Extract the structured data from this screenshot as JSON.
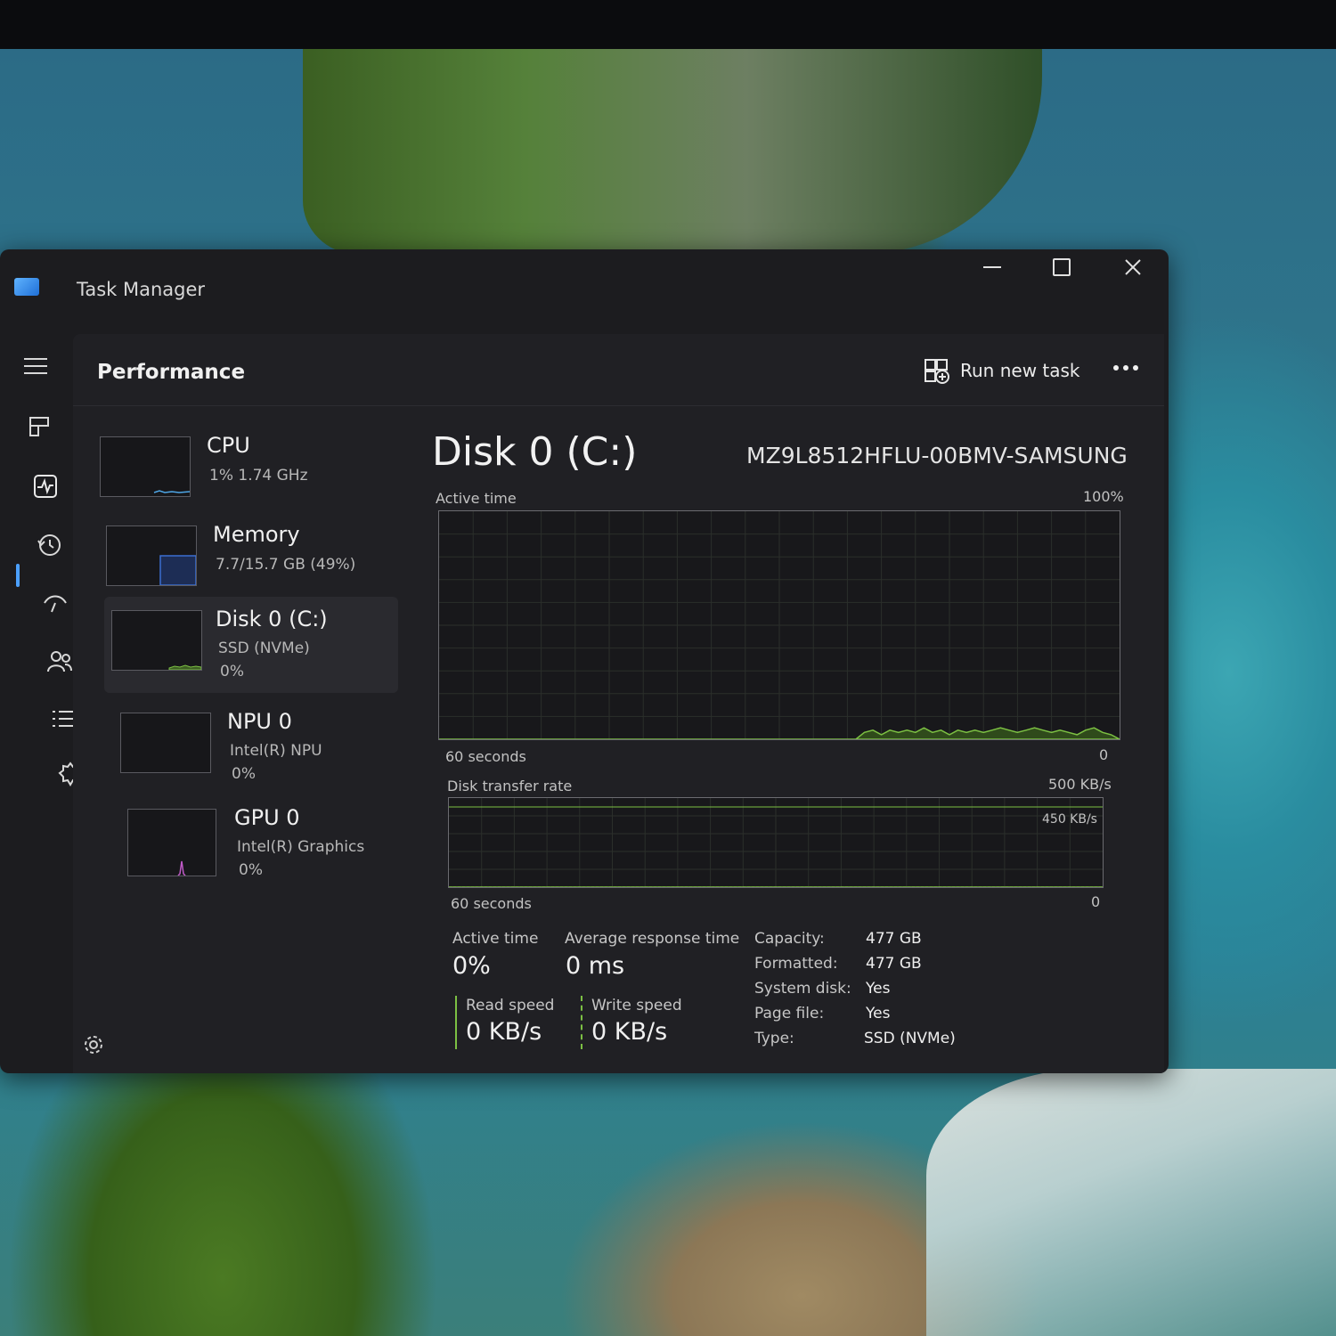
{
  "window": {
    "title": "Task Manager",
    "controls": {
      "minimize": "minimize-icon",
      "maximize": "maximize-icon",
      "close": "close-icon"
    }
  },
  "nav": {
    "items": [
      {
        "name": "menu",
        "icon": "hamburger-icon"
      },
      {
        "name": "processes",
        "icon": "processes-icon"
      },
      {
        "name": "performance",
        "icon": "performance-icon",
        "active": true
      },
      {
        "name": "app-history",
        "icon": "history-icon"
      },
      {
        "name": "startup-apps",
        "icon": "startup-icon"
      },
      {
        "name": "users",
        "icon": "users-icon"
      },
      {
        "name": "details",
        "icon": "details-list-icon"
      },
      {
        "name": "services",
        "icon": "services-icon"
      }
    ],
    "settings_icon": "settings-icon",
    "accent": "#4ca0ff"
  },
  "header": {
    "title": "Performance",
    "run_new_task": "Run new task",
    "more_icon": "more-icon"
  },
  "devices": [
    {
      "name": "CPU",
      "sub": "1%  1.74 GHz",
      "sub2": "",
      "color": "#4ea6e6"
    },
    {
      "name": "Memory",
      "sub": "7.7/15.7 GB (49%)",
      "sub2": "",
      "color": "#3b6fd1"
    },
    {
      "name": "Disk 0 (C:)",
      "sub": "SSD (NVMe)",
      "sub2": "0%",
      "color": "#7cc043",
      "selected": true
    },
    {
      "name": "NPU 0",
      "sub": "Intel(R) NPU",
      "sub2": "0%",
      "color": "#4ea6e6"
    },
    {
      "name": "GPU 0",
      "sub": "Intel(R) Graphics",
      "sub2": "0%",
      "color": "#c05ac8"
    }
  ],
  "detail": {
    "title": "Disk 0 (C:)",
    "model": "MZ9L8512HFLU-00BMV-SAMSUNG",
    "active_graph": {
      "label": "Active time",
      "max_label": "100%",
      "time_label": "60 seconds",
      "min_label": "0",
      "values": [
        0,
        0,
        0,
        0,
        0,
        0,
        0,
        0,
        0,
        0,
        0,
        0,
        0,
        0,
        0,
        0,
        0,
        0,
        0,
        0,
        0,
        0,
        0,
        0,
        0,
        0,
        0,
        0,
        0,
        0,
        0,
        0,
        0,
        0,
        0,
        0,
        0,
        0,
        0,
        0,
        0,
        0,
        0,
        0,
        0,
        0,
        0,
        0,
        0,
        0,
        3,
        4,
        2,
        4,
        3,
        4,
        3,
        5,
        3,
        4,
        2,
        4,
        3,
        4,
        3,
        4,
        5,
        4,
        3,
        4,
        5,
        4,
        3,
        4,
        3,
        2,
        4,
        5,
        3,
        2,
        0
      ]
    },
    "transfer_graph": {
      "label": "Disk transfer rate",
      "max_label": "500 KB/s",
      "line_label": "450 KB/s",
      "time_label": "60 seconds",
      "min_label": "0",
      "read_values": [
        0,
        0,
        0,
        0,
        0,
        0,
        0,
        0,
        0,
        0,
        0,
        0,
        0,
        0,
        0,
        0,
        0,
        0,
        0,
        0,
        0,
        0,
        0,
        0,
        0,
        0,
        0,
        0,
        0,
        0,
        0,
        0,
        0,
        0,
        0,
        0,
        0,
        0,
        0,
        0,
        0,
        0,
        0,
        0,
        0,
        0,
        0,
        0,
        0,
        0,
        0,
        0,
        0,
        0,
        0,
        0,
        0,
        0,
        0,
        0,
        0,
        0,
        0,
        0,
        0,
        0,
        0,
        0,
        0,
        0,
        0,
        0,
        0,
        0,
        0,
        0,
        0,
        0,
        0,
        0,
        0,
        0,
        0,
        0,
        0,
        0,
        0,
        0,
        0,
        0,
        0,
        0,
        0,
        0,
        0,
        0,
        0,
        0,
        0,
        0,
        0,
        0,
        0,
        0,
        0,
        0,
        0,
        0,
        0,
        0,
        0,
        0,
        0,
        0,
        0,
        0,
        0,
        0,
        0,
        0
      ],
      "write_values": [
        0,
        0,
        0,
        0,
        0,
        0,
        0,
        0,
        0,
        0,
        0,
        0,
        0,
        0,
        0,
        0,
        0,
        0,
        0,
        0,
        0,
        0,
        0,
        0,
        0,
        0,
        0,
        0,
        0,
        0,
        0,
        0,
        0,
        0,
        0,
        0,
        0,
        0,
        0,
        0,
        0,
        0,
        0,
        0,
        0,
        0,
        0,
        0,
        0,
        0,
        0,
        0,
        0,
        0,
        0,
        0,
        0,
        0,
        0,
        0,
        0,
        0,
        0,
        0,
        0,
        0,
        0,
        0,
        0,
        0,
        0,
        0,
        0,
        0,
        0,
        0,
        0,
        0,
        0,
        0,
        0,
        0,
        0,
        0,
        0,
        0,
        0,
        0,
        0,
        0,
        0,
        0,
        0,
        0,
        0,
        0,
        0,
        0,
        0,
        0,
        0,
        0,
        0,
        0,
        0,
        0,
        0,
        0,
        0,
        0,
        0,
        0,
        0,
        0,
        0,
        0,
        0,
        0,
        0,
        0
      ]
    },
    "stats": {
      "active_time_label": "Active time",
      "active_time": "0%",
      "avg_response_label": "Average response time",
      "avg_response": "0 ms",
      "read_label": "Read speed",
      "read": "0 KB/s",
      "write_label": "Write speed",
      "write": "0 KB/s"
    },
    "properties": [
      {
        "key": "Capacity:",
        "value": "477 GB"
      },
      {
        "key": "Formatted:",
        "value": "477 GB"
      },
      {
        "key": "System disk:",
        "value": "Yes"
      },
      {
        "key": "Page file:",
        "value": "Yes"
      },
      {
        "key": "Type:",
        "value": "SSD (NVMe)"
      }
    ],
    "colors": {
      "disk": "#7cc043",
      "read_bar": "#7cc043",
      "write_bar": "#7cc043"
    }
  }
}
